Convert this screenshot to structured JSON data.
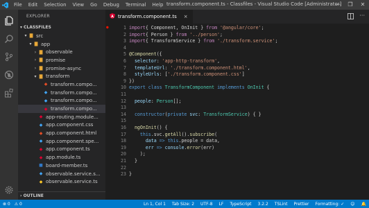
{
  "titlebar": {
    "menu": [
      "File",
      "Edit",
      "Selection",
      "View",
      "Go",
      "Debug",
      "Terminal",
      "Help"
    ],
    "window_title": "transform.component.ts - Classfiles - Visual Studio Code [Administrator]",
    "controls": [
      "—",
      "❐",
      "✕"
    ]
  },
  "activitybar": {
    "icons": [
      "files-icon",
      "search-icon",
      "source-control-icon",
      "debug-icon",
      "extensions-icon",
      "settings-icon"
    ]
  },
  "sidebar": {
    "title": "EXPLORER",
    "section": "CLASSFILES",
    "tree": [
      {
        "label": "src",
        "type": "folder-open",
        "depth": 1
      },
      {
        "label": "app",
        "type": "folder-open",
        "depth": 2
      },
      {
        "label": "observable",
        "type": "folder",
        "depth": 3
      },
      {
        "label": "promise",
        "type": "folder",
        "depth": 3
      },
      {
        "label": "promise-async",
        "type": "folder",
        "depth": 3
      },
      {
        "label": "transform",
        "type": "folder-open",
        "depth": 3
      },
      {
        "label": "transform.compo...",
        "type": "html",
        "depth": 4
      },
      {
        "label": "transform.compo...",
        "type": "css",
        "depth": 4
      },
      {
        "label": "transform.compo...",
        "type": "spec",
        "depth": 4
      },
      {
        "label": "transform.compo...",
        "type": "angular",
        "depth": 4,
        "selected": true
      },
      {
        "label": "app-routing.module...",
        "type": "angular",
        "depth": 3
      },
      {
        "label": "app.component.css",
        "type": "css",
        "depth": 3
      },
      {
        "label": "app.component.html",
        "type": "html",
        "depth": 3
      },
      {
        "label": "app.component.spe...",
        "type": "spec",
        "depth": 3
      },
      {
        "label": "app.component.ts",
        "type": "angular",
        "depth": 3
      },
      {
        "label": "app.module.ts",
        "type": "angular",
        "depth": 3
      },
      {
        "label": "board-member.ts",
        "type": "ts",
        "depth": 3
      },
      {
        "label": "observable.service.s...",
        "type": "spec",
        "depth": 3
      },
      {
        "label": "observable.service.ts",
        "type": "service",
        "depth": 3
      }
    ],
    "outline": "OUTLINE"
  },
  "tab": {
    "label": "transform.component.ts",
    "close": "×"
  },
  "editor": {
    "lines": [
      [
        [
          "kw",
          "import"
        ],
        [
          "",
          "{ Component, OnInit } "
        ],
        [
          "kw",
          "from"
        ],
        [
          "",
          ""
        ],
        [
          "str",
          " '@angular/core'"
        ],
        [
          "",
          ";"
        ]
      ],
      [
        [
          "kw",
          "import"
        ],
        [
          "",
          "{ Person } "
        ],
        [
          "kw",
          "from"
        ],
        [
          "str",
          " '../person'"
        ],
        [
          "",
          ";"
        ]
      ],
      [
        [
          "kw",
          "import"
        ],
        [
          "",
          "{ TransformService } "
        ],
        [
          "kw",
          "from"
        ],
        [
          "str",
          " './transform.service'"
        ],
        [
          "",
          ";"
        ]
      ],
      [],
      [
        [
          "dec",
          "@Component"
        ],
        [
          "",
          "({"
        ]
      ],
      [
        [
          "",
          ""
        ],
        [
          "var",
          "  selector"
        ],
        [
          "",
          ": "
        ],
        [
          "str",
          "'app-http-transform'"
        ],
        [
          "",
          ","
        ]
      ],
      [
        [
          "var",
          "  templateUrl"
        ],
        [
          "",
          ": "
        ],
        [
          "str",
          "'./transform.component.html'"
        ],
        [
          "",
          ","
        ]
      ],
      [
        [
          "var",
          "  styleUrls"
        ],
        [
          "",
          ": ["
        ],
        [
          "str",
          "'./transform.component.css'"
        ],
        [
          "",
          "]"
        ]
      ],
      [
        [
          "",
          "})"
        ]
      ],
      [
        [
          "kw2",
          "export"
        ],
        [
          "",
          ""
        ],
        [
          "kw2",
          " class"
        ],
        [
          "cls",
          " TransformComponent"
        ],
        [
          "kw2",
          " implements"
        ],
        [
          "cls",
          " OnInit"
        ],
        [
          "",
          " {"
        ]
      ],
      [],
      [
        [
          "var",
          "  people"
        ],
        [
          "",
          ": "
        ],
        [
          "cls",
          "Person"
        ],
        [
          "",
          "[];"
        ]
      ],
      [],
      [
        [
          "kw2",
          "  constructor"
        ],
        [
          "",
          "("
        ],
        [
          "kw2",
          "private"
        ],
        [
          "var",
          " svc"
        ],
        [
          "",
          ": "
        ],
        [
          "cls",
          "TransformService"
        ],
        [
          "",
          ") { }"
        ]
      ],
      [],
      [
        [
          "fn",
          "  ngOnInit"
        ],
        [
          "",
          "() {"
        ]
      ],
      [
        [
          "kw2",
          "    this"
        ],
        [
          "",
          ".svc."
        ],
        [
          "fn",
          "getAll"
        ],
        [
          "",
          "()."
        ],
        [
          "fn",
          "subscribe"
        ],
        [
          "",
          "("
        ]
      ],
      [
        [
          "var",
          "      data"
        ],
        [
          "kw2",
          " =>"
        ],
        [
          "kw2",
          " this"
        ],
        [
          "",
          ".people = data,"
        ]
      ],
      [
        [
          "var",
          "      err"
        ],
        [
          "kw2",
          " =>"
        ],
        [
          "var",
          " console"
        ],
        [
          "",
          "."
        ],
        [
          "fn",
          "error"
        ],
        [
          "",
          "(err)"
        ]
      ],
      [
        [
          "",
          "    );"
        ]
      ],
      [
        [
          "",
          "  }"
        ]
      ],
      [],
      [
        [
          "",
          "}"
        ]
      ]
    ]
  },
  "statusbar": {
    "left": [
      "⊗ 0",
      "⚠ 0"
    ],
    "right": [
      "Ln 1, Col 1",
      "Tab Size: 2",
      "UTF-8",
      "LF",
      "TypeScript",
      "3.2.2",
      "TSLint",
      "Prettier",
      "Formatting: ✓",
      "☺",
      "🔔"
    ]
  },
  "colors": {
    "accent": "#007acc",
    "sidebar_bg": "#252526",
    "editor_bg": "#1e1e1e",
    "angular_red": "#dd0031",
    "css_blue": "#42a5f5",
    "html_orange": "#e44d26"
  }
}
